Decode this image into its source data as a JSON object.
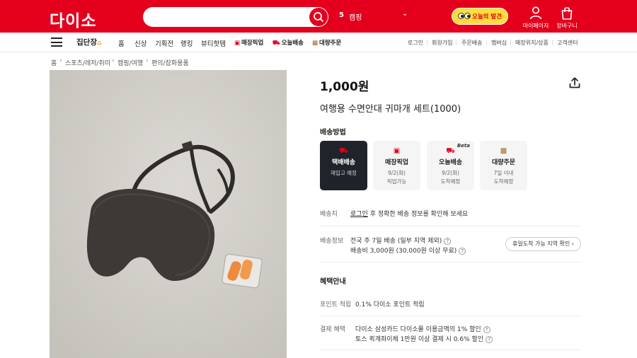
{
  "header": {
    "logo": "다이소",
    "search": {
      "placeholder": ""
    },
    "rank": {
      "number": "5",
      "keyword": "캠핑"
    },
    "today_label": "오늘의 발견",
    "mypage_label": "마이페이지",
    "cart_label": "장바구니"
  },
  "nav": {
    "brand_tab": "집단장",
    "items": [
      "홈",
      "신상",
      "기획전",
      "랭킹",
      "뷰티핫템"
    ],
    "special": [
      {
        "label": "매장픽업",
        "icon": "store-icon"
      },
      {
        "label": "오늘배송",
        "icon": "scooter-icon"
      },
      {
        "label": "대량주문",
        "icon": "box-icon"
      }
    ],
    "utility": [
      "로그인",
      "회원가입",
      "주문배송",
      "멤버십",
      "매장위치/상품",
      "고객센터"
    ]
  },
  "breadcrumb": [
    "홈",
    "스포츠/레저/취미",
    "캠핑/여행",
    "편의/잡화용품"
  ],
  "product": {
    "price": "1,000원",
    "name": "여행용 수면안대 귀마개 세트(1000)"
  },
  "shipping": {
    "title": "배송방법",
    "options": [
      {
        "name": "택배배송",
        "sub1": "재입고 예정",
        "sub2": "",
        "selected": true
      },
      {
        "name": "매장픽업",
        "sub1": "9/2(화)",
        "sub2": "픽업가능",
        "selected": false
      },
      {
        "name": "오늘배송",
        "sub1": "9/2(화)",
        "sub2": "도착예정",
        "badge": "Beta",
        "selected": false
      },
      {
        "name": "대량주문",
        "sub1": "7일 이내",
        "sub2": "도착예정",
        "selected": false
      }
    ]
  },
  "address": {
    "label": "배송지",
    "link": "로그인",
    "text": " 후 정확한 배송 정보를 확인해 보세요"
  },
  "ship_info": {
    "label": "배송정보",
    "line1": "전국 주 7일 배송 (일부 지역 제외)",
    "line2": "배송비 3,000원 (30,000원 이상 무료)",
    "holiday_btn": "휴일도착 가능 지역 확인"
  },
  "benefit": {
    "title": "혜택안내",
    "point_label": "포인트 적립",
    "point_text": "0.1% 다이소 포인트 적립",
    "pay_label": "결제 혜택",
    "pay_line1": "다이소 삼성카드 다이소몰 이용금액의 1% 할인",
    "pay_line2": "토스 퀵계좌이체 1만원 이상 결제 시 0.6% 할인"
  },
  "colors": {
    "brand": "#e4001d",
    "selected_card": "#1f242b"
  }
}
